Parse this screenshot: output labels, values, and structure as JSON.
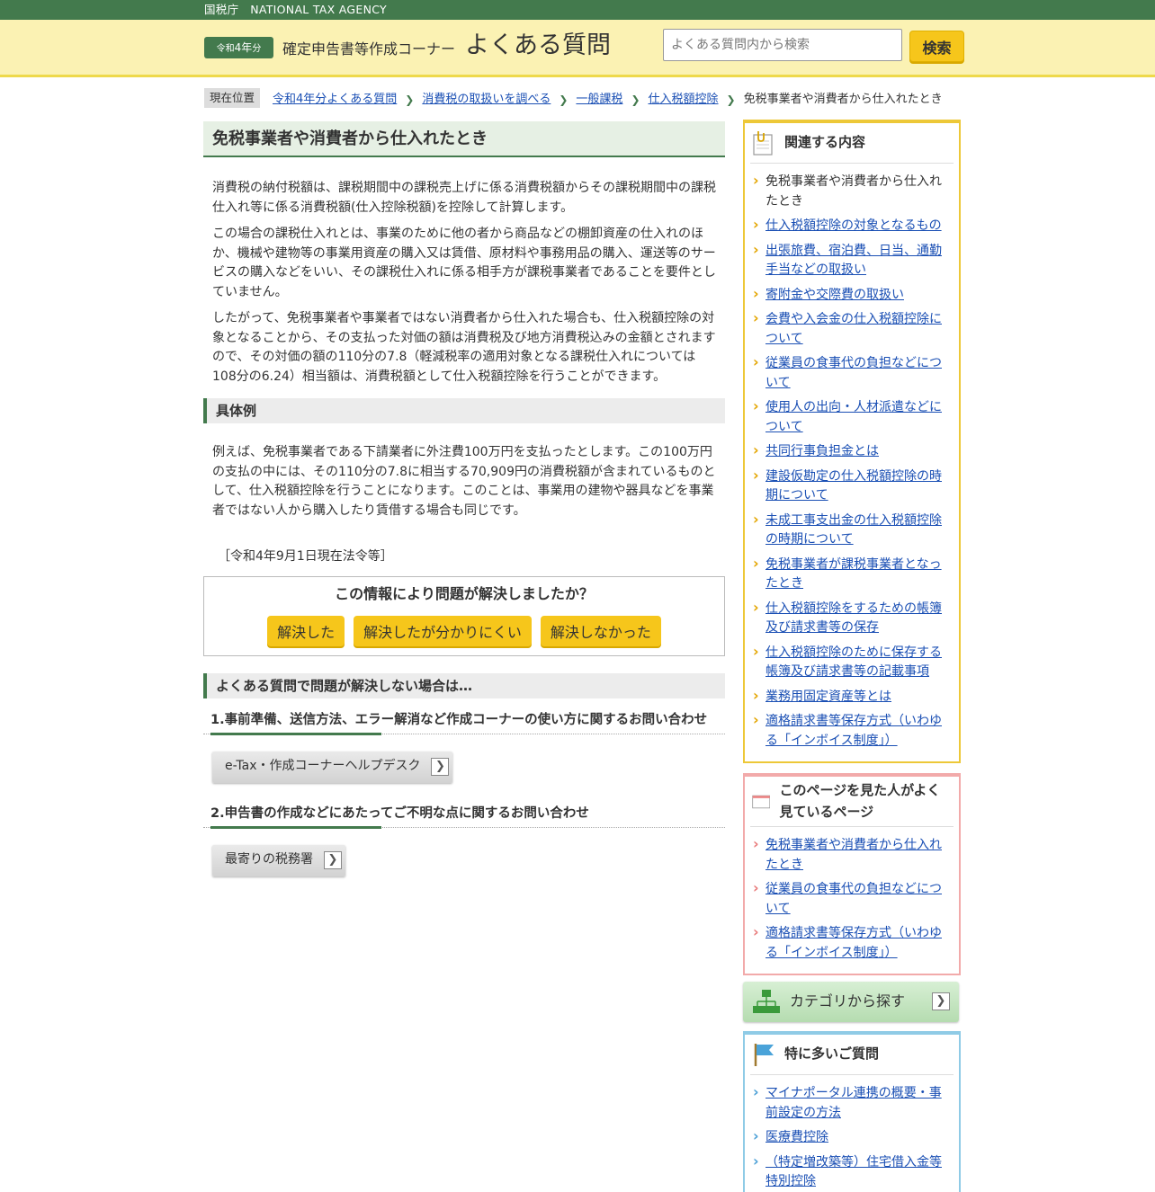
{
  "agency": "国税庁　NATIONAL TAX AGENCY",
  "header": {
    "year_prefix": "令和",
    "year_number": "4年",
    "year_suffix": "分",
    "corner_title": "確定申告書等作成コーナー",
    "faq_title": "よくある質問",
    "search_placeholder": "よくある質問内から検索",
    "search_button": "検索"
  },
  "breadcrumb": {
    "label": "現在位置",
    "items": [
      "令和4年分よくある質問",
      "消費税の取扱いを調べる",
      "一般課税",
      "仕入税額控除"
    ],
    "current": "免税事業者や消費者から仕入れたとき"
  },
  "main": {
    "title": "免税事業者や消費者から仕入れたとき",
    "paragraphs": [
      "消費税の納付税額は、課税期間中の課税売上げに係る消費税額からその課税期間中の課税仕入れ等に係る消費税額(仕入控除税額)を控除して計算します。",
      "この場合の課税仕入れとは、事業のために他の者から商品などの棚卸資産の仕入れのほか、機械や建物等の事業用資産の購入又は賃借、原材料や事務用品の購入、運送等のサービスの購入などをいい、その課税仕入れに係る相手方が課税事業者であることを要件としていません。",
      "したがって、免税事業者や事業者ではない消費者から仕入れた場合も、仕入税額控除の対象となることから、その支払った対価の額は消費税及び地方消費税込みの金額とされますので、その対価の額の110分の7.8（軽減税率の適用対象となる課税仕入れについては108分の6.24）相当額は、消費税額として仕入税額控除を行うことができます。"
    ],
    "example_heading": "具体例",
    "example_text": "例えば、免税事業者である下請業者に外注費100万円を支払ったとします。この100万円の支払の中には、その110分の7.8に相当する70,909円の消費税額が含まれているものとして、仕入税額控除を行うことになります。このことは、事業用の建物や器具などを事業者ではない人から購入したり賃借する場合も同じです。",
    "law_date": "［令和4年9月1日現在法令等］",
    "feedback": {
      "question": "この情報により問題が解決しましたか？",
      "resolved": "解決した",
      "resolved_hard": "解決したが分かりにくい",
      "not_resolved": "解決しなかった"
    },
    "unresolved_heading": "よくある質問で問題が解決しない場合は…",
    "inquiry1_heading": "1.事前準備、送信方法、エラー解消など作成コーナーの使い方に関するお問い合わせ",
    "inquiry1_button": "e-Tax・作成コーナーヘルプデスク",
    "inquiry2_heading": "2.申告書の作成などにあたってご不明な点に関するお問い合わせ",
    "inquiry2_button": "最寄りの税務署"
  },
  "sidebar": {
    "related": {
      "title": "関連する内容",
      "items": [
        "免税事業者や消費者から仕入れたとき",
        "仕入税額控除の対象となるもの",
        "出張旅費、宿泊費、日当、通勤手当などの取扱い",
        "寄附金や交際費の取扱い",
        "会費や入会金の仕入税額控除について",
        "従業員の食事代の負担などについて",
        "使用人の出向・人材派遣などについて",
        "共同行事負担金とは",
        "建設仮勘定の仕入税額控除の時期について",
        "未成工事支出金の仕入税額控除の時期について",
        "免税事業者が課税事業者となったとき",
        "仕入税額控除をするための帳簿及び請求書等の保存",
        "仕入税額控除のために保存する帳簿及び請求書等の記載事項",
        "業務用固定資産等とは",
        "適格請求書等保存方式（いわゆる「インボイス制度」）"
      ]
    },
    "viewed": {
      "title": "このページを見た人がよく見ているページ",
      "items": [
        "免税事業者や消費者から仕入れたとき",
        "従業員の食事代の負担などについて",
        "適格請求書等保存方式（いわゆる「インボイス制度」）"
      ]
    },
    "category_button": "カテゴリから探す",
    "popular": {
      "title": "特に多いご質問",
      "items": [
        "マイナポータル連携の概要・事前設定の方法",
        "医療費控除",
        "（特定増改築等）住宅借入金等特別控除"
      ]
    }
  }
}
